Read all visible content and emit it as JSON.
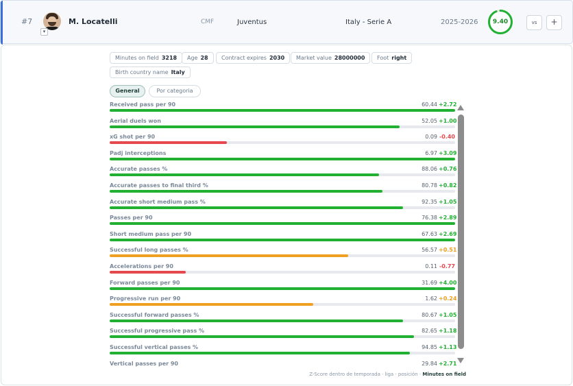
{
  "header": {
    "rank": "#7",
    "player_name": "M. Locatelli",
    "position": "CMF",
    "team": "Juventus",
    "league": "Italy - Serie A",
    "season": "2025-2026",
    "score": "9.40",
    "score_fraction": 0.94,
    "score_color": "#22b033",
    "vs_label": "vs",
    "add_label": "+",
    "expand_icon": "chevron-down-icon"
  },
  "info": [
    {
      "label": "Minutes on field",
      "value": "3218"
    },
    {
      "label": "Age",
      "value": "28"
    },
    {
      "label": "Contract expires",
      "value": "2030"
    },
    {
      "label": "Market value",
      "value": "28000000"
    },
    {
      "label": "Foot",
      "value": "right"
    },
    {
      "label": "Birth country name",
      "value": "Italy"
    }
  ],
  "tabs": [
    {
      "label": "General",
      "active": true
    },
    {
      "label": "Por categoria",
      "active": false
    }
  ],
  "colors": {
    "green": "#22b033",
    "red": "#e5484d",
    "orange": "#f0a020",
    "delta_green": "#22b033",
    "delta_red": "#e5484d",
    "delta_orange": "#f0a020"
  },
  "metrics": [
    {
      "label": "Received pass per 90",
      "value": "60.44",
      "delta": "+2.72",
      "level": 1.0,
      "status": "green"
    },
    {
      "label": "Aerial duels won",
      "value": "52.05",
      "delta": "+1.00",
      "level": 0.84,
      "status": "green"
    },
    {
      "label": "xG shot per 90",
      "value": "0.09",
      "delta": "-0.40",
      "level": 0.34,
      "status": "red"
    },
    {
      "label": "Padj interceptions",
      "value": "6.97",
      "delta": "+3.09",
      "level": 1.0,
      "status": "green"
    },
    {
      "label": "Accurate passes %",
      "value": "88.06",
      "delta": "+0.76",
      "level": 0.78,
      "status": "green"
    },
    {
      "label": "Accurate passes to final third %",
      "value": "80.78",
      "delta": "+0.82",
      "level": 0.79,
      "status": "green"
    },
    {
      "label": "Accurate short medium pass %",
      "value": "92.35",
      "delta": "+1.05",
      "level": 0.85,
      "status": "green"
    },
    {
      "label": "Passes per 90",
      "value": "76.38",
      "delta": "+2.89",
      "level": 1.0,
      "status": "green"
    },
    {
      "label": "Short medium pass per 90",
      "value": "67.63",
      "delta": "+2.69",
      "level": 1.0,
      "status": "green"
    },
    {
      "label": "Successful long passes %",
      "value": "56.57",
      "delta": "+0.51",
      "level": 0.69,
      "status": "orange"
    },
    {
      "label": "Accelerations per 90",
      "value": "0.11",
      "delta": "-0.77",
      "level": 0.22,
      "status": "red"
    },
    {
      "label": "Forward passes per 90",
      "value": "31.69",
      "delta": "+4.00",
      "level": 1.0,
      "status": "green"
    },
    {
      "label": "Progressive run per 90",
      "value": "1.62",
      "delta": "+0.24",
      "level": 0.59,
      "status": "orange"
    },
    {
      "label": "Successful forward passes %",
      "value": "80.67",
      "delta": "+1.05",
      "level": 0.85,
      "status": "green"
    },
    {
      "label": "Successful progressive pass %",
      "value": "82.65",
      "delta": "+1.18",
      "level": 0.88,
      "status": "green"
    },
    {
      "label": "Successful vertical passes %",
      "value": "94.85",
      "delta": "+1.13",
      "level": 0.87,
      "status": "green"
    },
    {
      "label": "Vertical passes per 90",
      "value": "29.84",
      "delta": "+2.71",
      "level": 1.0,
      "status": "green"
    }
  ],
  "footnote": {
    "prefix": "Z-Score dentro de temporada · liga · posición · ",
    "highlight": "Minutes on field"
  }
}
